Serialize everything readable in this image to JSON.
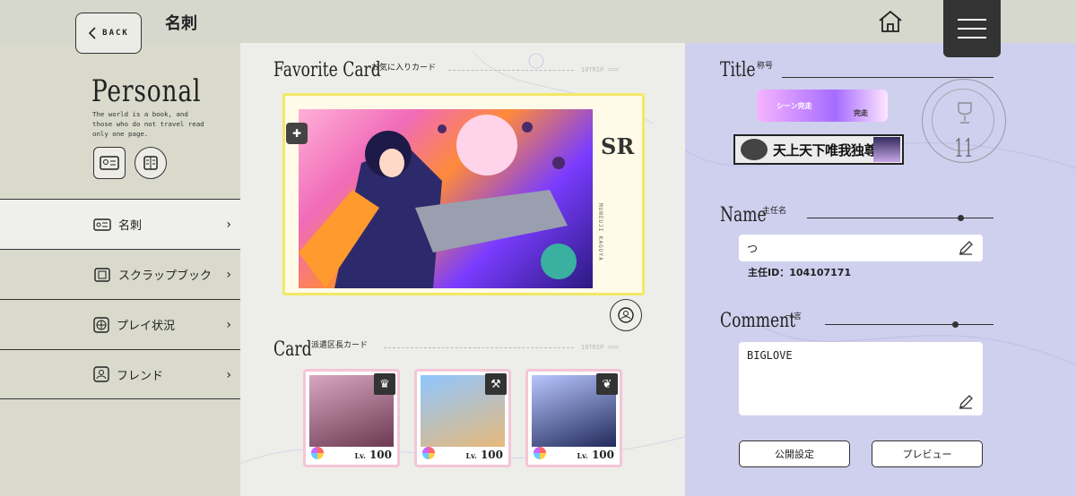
{
  "header": {
    "back_label": "BACK",
    "page_title": "名刺"
  },
  "sidebar": {
    "title": "Personal",
    "description": "The world is a book, and those who do not travel read only one page.",
    "items": [
      {
        "label": "名刺",
        "icon": "id-card-icon"
      },
      {
        "label": "スクラップブック",
        "icon": "scrapbook-icon"
      },
      {
        "label": "プレイ状況",
        "icon": "globe-icon"
      },
      {
        "label": "フレンド",
        "icon": "friend-icon"
      }
    ]
  },
  "favorite": {
    "title": "Favorite Card",
    "subtitle": "お気に入りカード",
    "trip": "10TRIP ===",
    "rarity": "SR",
    "vertical_name": "MUNEUJI KAGUYA"
  },
  "cards": {
    "title": "Card",
    "subtitle": "派遣区長カード",
    "trip": "10TRIP ===",
    "items": [
      {
        "lv_prefix": "Lv.",
        "lv": "100",
        "attr_icon": "crown-icon",
        "colors": [
          "#d8a6c0",
          "#6b3a52"
        ]
      },
      {
        "lv_prefix": "Lv.",
        "lv": "100",
        "attr_icon": "drill-icon",
        "colors": [
          "#8fc6ff",
          "#e7b97a"
        ]
      },
      {
        "lv_prefix": "Lv.",
        "lv": "100",
        "attr_icon": "leaf-icon",
        "colors": [
          "#b8c6ff",
          "#222a5a"
        ]
      }
    ]
  },
  "right": {
    "title_label": "Title",
    "title_sub": "称号",
    "plate_top_text": "シーン完走",
    "plate_top_badge": "完走",
    "plate_main_text": "天上天下唯我独尊",
    "badge_number": "11",
    "name_label": "Name",
    "name_sub": "主任名",
    "name_value": "つ",
    "id_label": "主任ID：104107171",
    "comment_label": "Comment",
    "comment_sub": "一言",
    "comment_value": "BIGLOVE",
    "public_btn": "公開設定",
    "preview_btn": "プレビュー"
  },
  "colors": {
    "topbar": "#d6d7cd",
    "sidebar": "#d9dacc",
    "right_panel": "#cfcfee",
    "card_border": "#f2e866"
  }
}
